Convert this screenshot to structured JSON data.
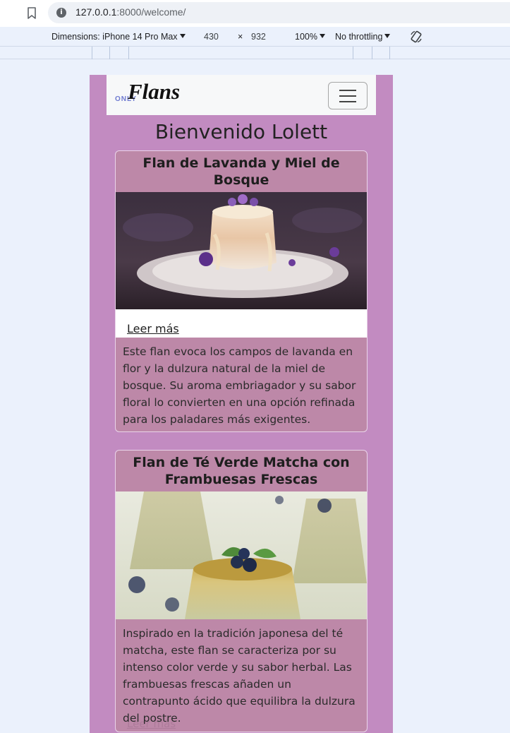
{
  "browser": {
    "url_host": "127.0.0.1",
    "url_rest": ":8000/welcome/"
  },
  "devtools": {
    "dimensions_label": "Dimensions: iPhone 14 Pro Max",
    "width": "430",
    "times": "×",
    "height": "932",
    "zoom": "100%",
    "throttling": "No throttling"
  },
  "navbar": {
    "logo_only": "ONLY",
    "logo_flans": "Flans"
  },
  "page": {
    "welcome": "Bienvenido Lolett"
  },
  "cards": [
    {
      "title": "Flan de Lavanda y Miel de Bosque",
      "read_more": "Leer más",
      "description": "Este flan evoca los campos de lavanda en flor y la dulzura natural de la miel de bosque. Su aroma embriagador y su sabor floral lo convierten en una opción refinada para los paladares más exigentes."
    },
    {
      "title": "Flan de Té Verde Matcha con Frambuesas Frescas",
      "read_more": "Leer más",
      "description": "Inspirado en la tradición japonesa del té matcha, este flan se caracteriza por su intenso color verde y su sabor herbal. Las frambuesas frescas añaden un contrapunto ácido que equilibra la dulzura del postre."
    }
  ]
}
